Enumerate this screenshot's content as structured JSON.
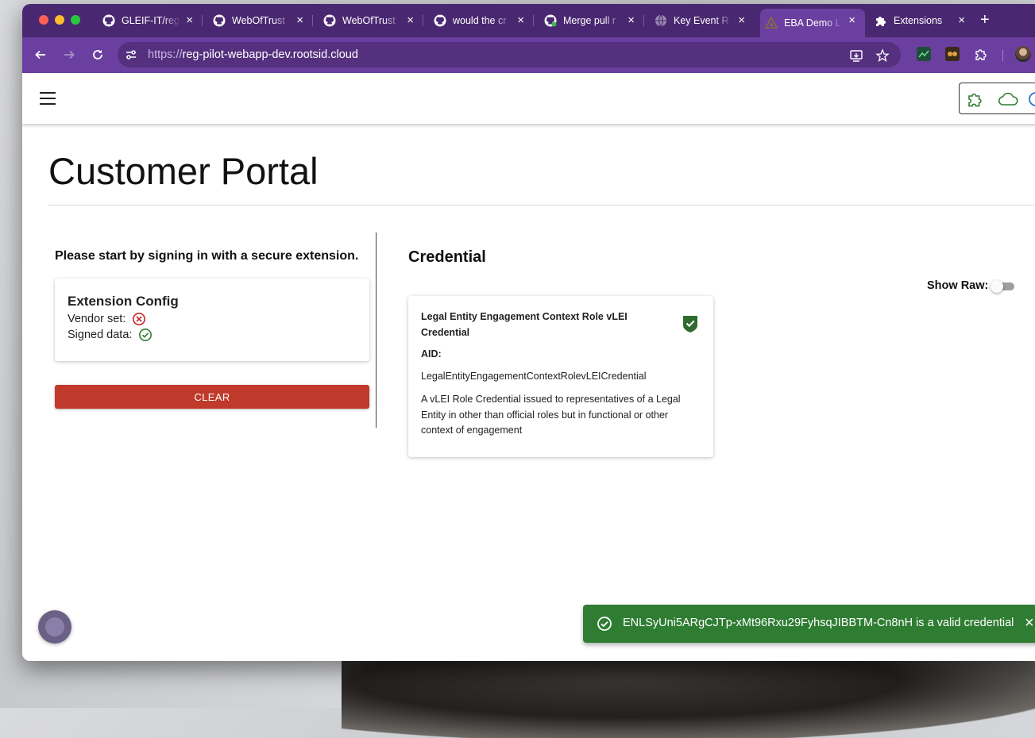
{
  "browser": {
    "tabs": [
      {
        "label": "GLEIF-IT/reg",
        "icon": "github-icon"
      },
      {
        "label": "WebOfTrust",
        "icon": "github-icon"
      },
      {
        "label": "WebOfTrust",
        "icon": "github-icon"
      },
      {
        "label": "would the cr",
        "icon": "github-icon"
      },
      {
        "label": "Merge pull r",
        "icon": "github-merge-icon"
      },
      {
        "label": "Key Event R",
        "icon": "globe-icon"
      },
      {
        "label": "EBA Demo L",
        "icon": "eba-logo-icon"
      },
      {
        "label": "Extensions",
        "icon": "puzzle-icon"
      }
    ],
    "tab_close_glyph": "×",
    "new_tab_glyph": "+",
    "url_scheme": "https://",
    "url_host": "reg-pilot-webapp-dev.rootsid.cloud"
  },
  "page": {
    "title": "Customer Portal",
    "prompt": "Please start by signing in with a secure extension.",
    "extension_config": {
      "title": "Extension Config",
      "vendor_label": "Vendor set:",
      "vendor_status": "error",
      "signed_label": "Signed data:",
      "signed_status": "ok"
    },
    "clear_label": "CLEAR",
    "credential": {
      "heading": "Credential",
      "show_raw_label": "Show Raw:",
      "show_raw_on": false,
      "name": "Legal Entity Engagement Context Role vLEI Credential",
      "aid_label": "AID:",
      "schema": "LegalEntityEngagementContextRolevLEICredential",
      "description": "A vLEI Role Credential issued to representatives of a Legal Entity in other than official roles but in functional or other context of engagement",
      "verified": true
    },
    "snackbar": {
      "message": "ENLSyUni5ARgCJTp-xMt96Rxu29FyhsqJIBBTM-Cn8nH is a valid credential",
      "close_glyph": "×"
    }
  },
  "colors": {
    "browser_frame": "#4a2871",
    "toolbar": "#6b3fa0",
    "clear_button": "#c0392b",
    "success": "#2e7d32",
    "verified_shield": "#2e6b2f",
    "error_icon": "#c62828"
  }
}
